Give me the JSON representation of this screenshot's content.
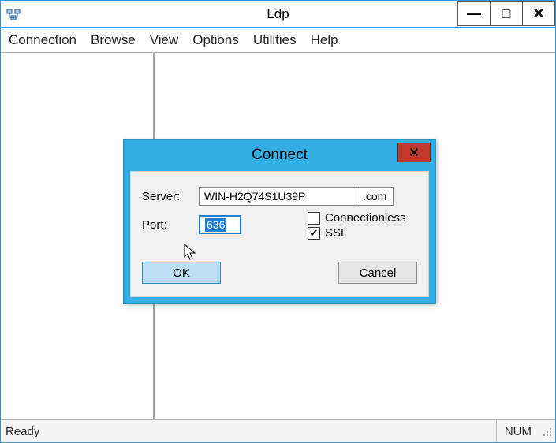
{
  "window": {
    "title": "Ldp",
    "minimize_glyph": "—",
    "maximize_glyph": "□",
    "close_glyph": "✕"
  },
  "menu": {
    "items": [
      "Connection",
      "Browse",
      "View",
      "Options",
      "Utilities",
      "Help"
    ]
  },
  "status": {
    "text": "Ready",
    "indicator": "NUM"
  },
  "dialog": {
    "title": "Connect",
    "close_glyph": "✕",
    "server_label": "Server:",
    "server_value": "WIN-H2Q74S1U39P",
    "server_suffix": ".com",
    "port_label": "Port:",
    "port_value": "636",
    "connectionless_label": "Connectionless",
    "connectionless_checked": false,
    "ssl_label": "SSL",
    "ssl_checked": true,
    "ssl_check_glyph": "✔",
    "ok_label": "OK",
    "cancel_label": "Cancel"
  }
}
